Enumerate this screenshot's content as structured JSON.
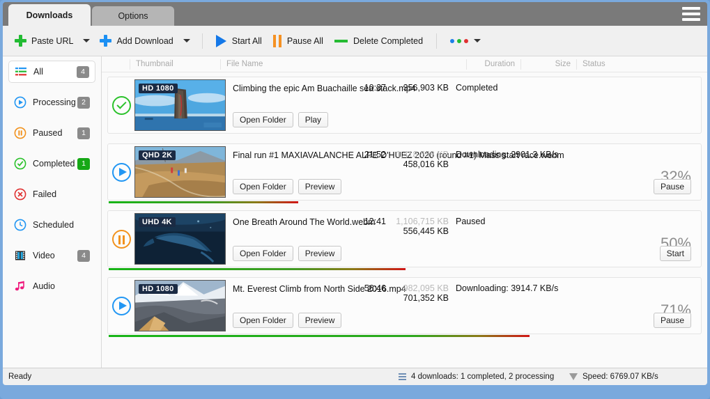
{
  "tabs": [
    {
      "label": "Downloads",
      "active": true
    },
    {
      "label": "Options",
      "active": false
    }
  ],
  "toolbar": {
    "paste_url": "Paste URL",
    "add_download": "Add Download",
    "start_all": "Start All",
    "pause_all": "Pause All",
    "delete_completed": "Delete Completed",
    "more_dots": [
      "#1c7fe8",
      "#22bb33",
      "#e03131"
    ]
  },
  "sidebar": {
    "items": [
      {
        "label": "All",
        "icon": "list-icon",
        "badge": "4",
        "badge_color": "#8a8a8a",
        "selected": true
      },
      {
        "label": "Processing",
        "icon": "play-circle-icon",
        "badge": "2",
        "badge_color": "#8a8a8a",
        "selected": false
      },
      {
        "label": "Paused",
        "icon": "pause-circle-icon",
        "badge": "1",
        "badge_color": "#8a8a8a",
        "selected": false
      },
      {
        "label": "Completed",
        "icon": "check-circle-icon",
        "badge": "1",
        "badge_color": "#16a816",
        "selected": false
      },
      {
        "label": "Failed",
        "icon": "error-circle-icon",
        "badge": "",
        "badge_color": "",
        "selected": false
      },
      {
        "label": "Scheduled",
        "icon": "clock-icon",
        "badge": "",
        "badge_color": "",
        "selected": false
      },
      {
        "label": "Video",
        "icon": "film-icon",
        "badge": "4",
        "badge_color": "#8a8a8a",
        "selected": false
      },
      {
        "label": "Audio",
        "icon": "music-note-icon",
        "badge": "",
        "badge_color": "",
        "selected": false
      }
    ]
  },
  "columns": {
    "thumbnail": "Thumbnail",
    "file_name": "File Name",
    "duration": "Duration",
    "size": "Size",
    "status": "Status"
  },
  "downloads": [
    {
      "state_icon": "check-circle-icon",
      "quality": "HD 1080",
      "file_name": "Climbing the epic Am Buachaille sea stack.mp4",
      "duration": "10:37",
      "size_total": "356,903 KB",
      "size_done": "",
      "status": "Completed",
      "percent": "",
      "progress": 100,
      "buttons": [
        "Open Folder",
        "Play"
      ],
      "action_button": "",
      "show_progress_bar": false
    },
    {
      "state_icon": "play-circle-icon",
      "quality": "QHD 2K",
      "file_name": "Final run #1  MAXIAVALANCHE ALPE D'HUEZ 2020 (round #1) Mass start race.webm",
      "duration": "21:52",
      "size_total": "1,418,558 KB",
      "size_done": "458,016 KB",
      "status": "Downloading: 2901.3 KB/s",
      "percent": "32%",
      "progress": 32,
      "buttons": [
        "Open Folder",
        "Preview"
      ],
      "action_button": "Pause",
      "show_progress_bar": true
    },
    {
      "state_icon": "pause-circle-icon",
      "quality": "UHD 4K",
      "file_name": "One Breath Around The World.webm",
      "duration": "12:41",
      "size_total": "1,106,715 KB",
      "size_done": "556,445 KB",
      "status": "Paused",
      "percent": "50%",
      "progress": 50,
      "buttons": [
        "Open Folder",
        "Preview"
      ],
      "action_button": "Start",
      "show_progress_bar": true
    },
    {
      "state_icon": "play-circle-icon",
      "quality": "HD 1080",
      "file_name": "Mt. Everest Climb from North Side 2016.mp4",
      "duration": "56:46",
      "size_total": "982,095 KB",
      "size_done": "701,352 KB",
      "status": "Downloading: 3914.7 KB/s",
      "percent": "71%",
      "progress": 71,
      "buttons": [
        "Open Folder",
        "Preview"
      ],
      "action_button": "Pause",
      "show_progress_bar": true
    }
  ],
  "statusbar": {
    "ready": "Ready",
    "summary": "4 downloads: 1 completed, 2 processing",
    "speed": "Speed: 6769.07 KB/s"
  }
}
